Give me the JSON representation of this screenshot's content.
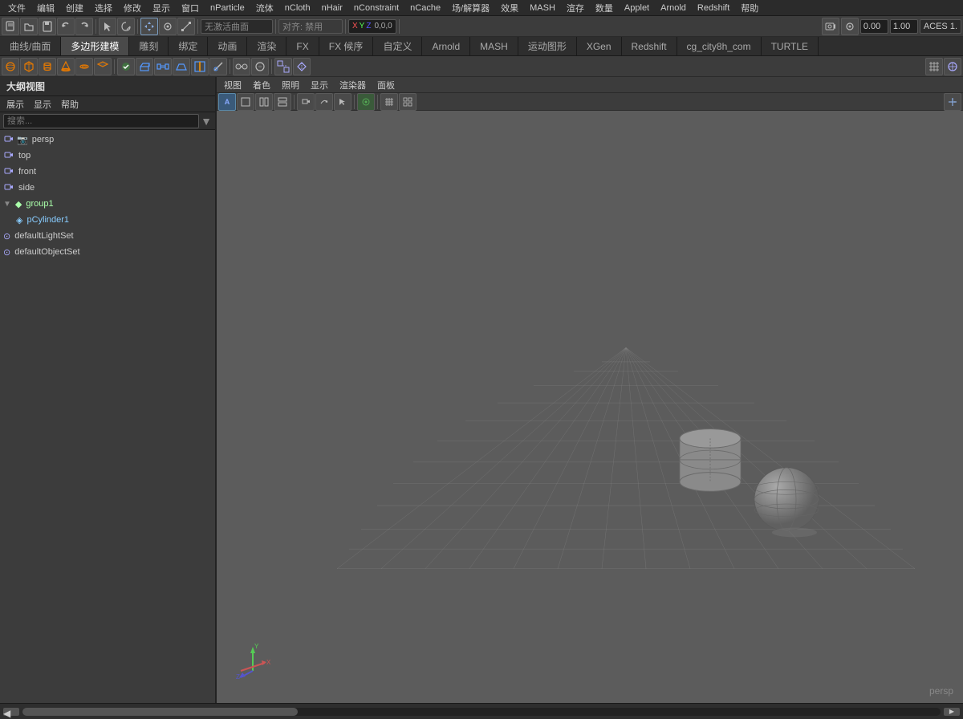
{
  "menu": {
    "items": [
      "文件",
      "编辑",
      "创建",
      "选择",
      "修改",
      "显示",
      "窗口",
      "nParticle",
      "流体",
      "nCloth",
      "nHair",
      "nConstraint",
      "nCache",
      "场/解算器",
      "效果",
      "MASH",
      "渲存",
      "数量",
      "Applet",
      "Arnold",
      "Redshift",
      "帮助"
    ]
  },
  "toolbar1": {
    "new_label": "新建",
    "open_label": "打开",
    "save_label": "保存",
    "active_curve": "无激活曲面",
    "align_label": "对齐: 禁用",
    "coords": "0,0,0",
    "value1": "0.00",
    "value2": "1.00",
    "renderer": "ACES 1."
  },
  "tabs": {
    "items": [
      "曲线/曲面",
      "多边形建模",
      "雕刻",
      "绑定",
      "动画",
      "渲染",
      "FX",
      "FX 候序",
      "自定义",
      "Arnold",
      "MASH",
      "运动图形",
      "XGen",
      "Redshift",
      "cg_city8h_com",
      "TURTLE"
    ]
  },
  "outliner": {
    "title": "大纲视图",
    "menu_items": [
      "展示",
      "显示",
      "帮助"
    ],
    "search_placeholder": "搜索...",
    "items": [
      {
        "indent": 0,
        "type": "camera",
        "label": "persp",
        "expanded": false
      },
      {
        "indent": 0,
        "type": "camera",
        "label": "top",
        "expanded": false
      },
      {
        "indent": 0,
        "type": "camera",
        "label": "front",
        "expanded": false
      },
      {
        "indent": 0,
        "type": "camera",
        "label": "side",
        "expanded": false
      },
      {
        "indent": 0,
        "type": "group",
        "label": "group1",
        "expanded": true
      },
      {
        "indent": 1,
        "type": "object",
        "label": "pCylinder1",
        "expanded": false
      },
      {
        "indent": 0,
        "type": "lightset",
        "label": "defaultLightSet",
        "expanded": false
      },
      {
        "indent": 0,
        "type": "objectset",
        "label": "defaultObjectSet",
        "expanded": false
      }
    ]
  },
  "viewport": {
    "menu_items": [
      "视图",
      "着色",
      "照明",
      "显示",
      "渲染器",
      "面板"
    ],
    "camera_label": "persp",
    "axis_x": "X",
    "axis_y": "Y",
    "axis_z": "Z"
  },
  "statusbar": {
    "persp_label": "persp"
  }
}
